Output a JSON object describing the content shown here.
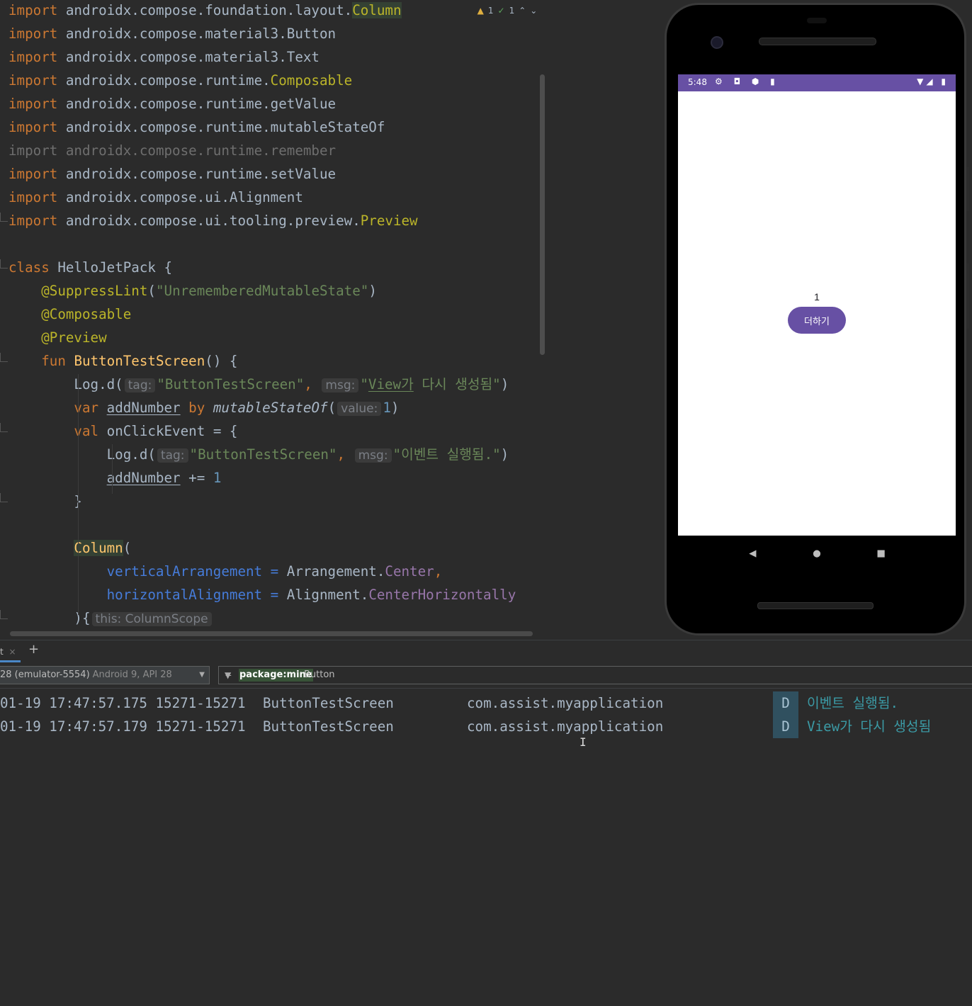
{
  "editor": {
    "inspection": {
      "warnings": "1",
      "weak_warnings": "1"
    },
    "imports": [
      {
        "kw": "import",
        "pkg": "androidx.compose.foundation.layout.",
        "name": "Column",
        "name_style": "hl"
      },
      {
        "kw": "import",
        "pkg": "androidx.compose.material3.",
        "name": "Button",
        "name_style": "plain"
      },
      {
        "kw": "import",
        "pkg": "androidx.compose.material3.",
        "name": "Text",
        "name_style": "plain"
      },
      {
        "kw": "import",
        "pkg": "androidx.compose.runtime.",
        "name": "Composable",
        "name_style": "ann"
      },
      {
        "kw": "import",
        "pkg": "androidx.compose.runtime.",
        "name": "getValue",
        "name_style": "plain"
      },
      {
        "kw": "import",
        "pkg": "androidx.compose.runtime.",
        "name": "mutableStateOf",
        "name_style": "plain"
      },
      {
        "kw": "import",
        "pkg": "androidx.compose.runtime.",
        "name": "remember",
        "name_style": "dim"
      },
      {
        "kw": "import",
        "pkg": "androidx.compose.runtime.",
        "name": "setValue",
        "name_style": "plain"
      },
      {
        "kw": "import",
        "pkg": "androidx.compose.ui.",
        "name": "Alignment",
        "name_style": "plain"
      },
      {
        "kw": "import",
        "pkg": "androidx.compose.ui.tooling.preview.",
        "name": "Preview",
        "name_style": "ann"
      }
    ],
    "class_kw": "class",
    "class_name": "HelloJetPack {",
    "suppress_ann": "@SuppressLint",
    "suppress_arg": "\"UnrememberedMutableState\"",
    "composable_ann": "@Composable",
    "preview_ann": "@Preview",
    "fun_kw": "fun",
    "fun_name": "ButtonTestScreen",
    "fun_tail": "() {",
    "log1_call": "Log.d(",
    "hint_tag": "tag:",
    "log1_tag": "\"ButtonTestScreen\"",
    "hint_msg": "msg:",
    "log1_msg_q": "\"",
    "log1_msg_view": "View가",
    "log1_msg_rest": " 다시 생성됨\"",
    "close_paren": ")",
    "var_kw": "var",
    "var_name": "addNumber",
    "by_kw": "by",
    "mutable_call": "mutableStateOf",
    "hint_value": "value:",
    "num_one": "1",
    "val_kw": "val",
    "val_name": "onClickEvent = {",
    "log2_call": "Log.d(",
    "log2_tag": "\"ButtonTestScreen\"",
    "log2_msg": "\"이벤트 실행됨.\"",
    "plus_assign": " += ",
    "close_brace": "}",
    "column_call": "Column",
    "open_paren": "(",
    "vert_param": "verticalArrangement",
    "eq": " = ",
    "arr_obj": "Arrangement.",
    "arr_val": "Center",
    "comma": ",",
    "horiz_param": "horizontalAlignment",
    "align_obj": "Alignment.",
    "align_val": "CenterHorizontally",
    "lambda_open": "){",
    "hint_scope": "this: ColumnScope"
  },
  "emulator": {
    "status_time": "5:48",
    "status_left_icons": "⚙ ◘ ⬢ ▮",
    "status_right_icons": "▼◢ ▮",
    "counter_value": "1",
    "button_label": "더하기",
    "nav_back": "◀",
    "nav_home": "●",
    "nav_recent": "■"
  },
  "logcat": {
    "tab_label": "t",
    "tab_close": "×",
    "tab_add": "+",
    "device_name": "28 (emulator-5554)",
    "device_extra": "Android 9, API 28",
    "filter_key": "package:mine",
    "filter_rest": "Button",
    "rows": [
      {
        "timestamp": "01-19 17:47:57.175 15271-15271",
        "tag": "ButtonTestScreen",
        "package": "com.assist.myapplication",
        "level": "D",
        "message": "이벤트 실행됨."
      },
      {
        "timestamp": "01-19 17:47:57.179 15271-15271",
        "tag": "ButtonTestScreen",
        "package": "com.assist.myapplication",
        "level": "D",
        "message": "View가 다시 생성됨"
      }
    ]
  },
  "colors": {
    "editor_bg": "#2b2b2b",
    "keyword": "#cc7832",
    "string": "#6a8759",
    "annotation": "#bbb529",
    "accent_purple": "#6750a4"
  }
}
